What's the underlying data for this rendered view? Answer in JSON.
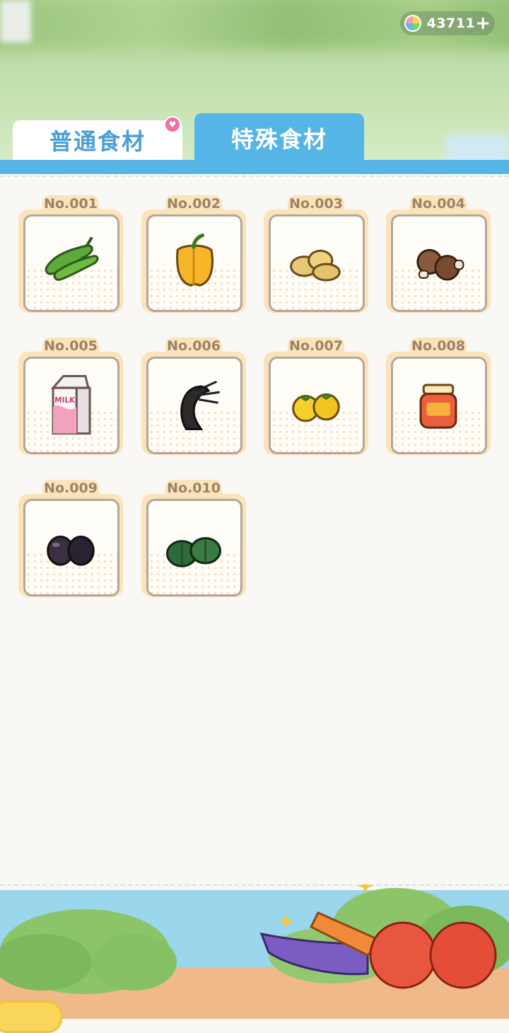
{
  "currency": {
    "icon": "rainbow-gem-icon",
    "amount": "43711",
    "add_label": "+"
  },
  "tabs": [
    {
      "label": "普通食材",
      "active": false,
      "has_notification": true
    },
    {
      "label": "特殊食材",
      "active": true
    }
  ],
  "ingredients": [
    {
      "number": "No.001",
      "icon": "green-pepper-icon"
    },
    {
      "number": "No.002",
      "icon": "yellow-bell-pepper-icon"
    },
    {
      "number": "No.003",
      "icon": "potatoes-icon"
    },
    {
      "number": "No.004",
      "icon": "mushrooms-icon"
    },
    {
      "number": "No.005",
      "icon": "milk-carton-icon"
    },
    {
      "number": "No.006",
      "icon": "black-shrimp-icon"
    },
    {
      "number": "No.007",
      "icon": "yellow-tomatoes-icon"
    },
    {
      "number": "No.008",
      "icon": "honey-jar-icon"
    },
    {
      "number": "No.009",
      "icon": "black-eggs-icon"
    },
    {
      "number": "No.010",
      "icon": "green-pumpkins-icon"
    }
  ],
  "colors": {
    "accent_blue": "#55b5e6",
    "card_frame": "#fbe3bb",
    "label_text": "#9a8467"
  }
}
